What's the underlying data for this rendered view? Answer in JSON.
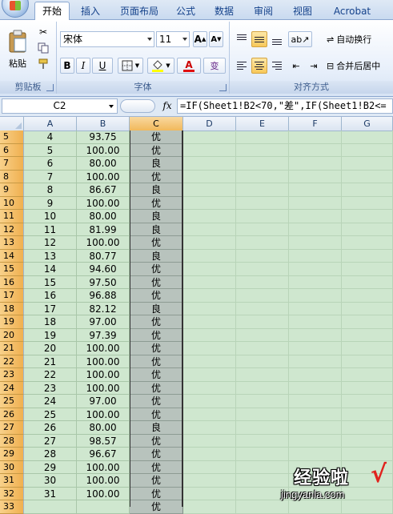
{
  "tabs": [
    "开始",
    "插入",
    "页面布局",
    "公式",
    "数据",
    "审阅",
    "视图",
    "Acrobat"
  ],
  "active_tab": "开始",
  "ribbon": {
    "clipboard": {
      "label": "剪贴板",
      "paste_label": "粘贴"
    },
    "font": {
      "label": "字体",
      "font_name": "宋体",
      "font_size": "11",
      "grow_label": "A",
      "shrink_label": "A",
      "bold": "B",
      "italic": "I",
      "underline": "U",
      "font_color_label": "A",
      "phonetic_label": "变"
    },
    "alignment": {
      "label": "对齐方式",
      "wrap_text": "自动换行",
      "merge_center": "合并后居中"
    }
  },
  "formula_bar": {
    "name_box": "C2",
    "fx": "fx",
    "formula": "=IF(Sheet1!B2<70,\"差\",IF(Sheet1!B2<="
  },
  "columns": [
    "A",
    "B",
    "C",
    "D",
    "E",
    "F",
    "G"
  ],
  "rows": [
    {
      "r": "5",
      "a": "4",
      "b": "93.75",
      "c": "优"
    },
    {
      "r": "6",
      "a": "5",
      "b": "100.00",
      "c": "优"
    },
    {
      "r": "7",
      "a": "6",
      "b": "80.00",
      "c": "良"
    },
    {
      "r": "8",
      "a": "7",
      "b": "100.00",
      "c": "优"
    },
    {
      "r": "9",
      "a": "8",
      "b": "86.67",
      "c": "良"
    },
    {
      "r": "10",
      "a": "9",
      "b": "100.00",
      "c": "优"
    },
    {
      "r": "11",
      "a": "10",
      "b": "80.00",
      "c": "良"
    },
    {
      "r": "12",
      "a": "11",
      "b": "81.99",
      "c": "良"
    },
    {
      "r": "13",
      "a": "12",
      "b": "100.00",
      "c": "优"
    },
    {
      "r": "14",
      "a": "13",
      "b": "80.77",
      "c": "良"
    },
    {
      "r": "15",
      "a": "14",
      "b": "94.60",
      "c": "优"
    },
    {
      "r": "16",
      "a": "15",
      "b": "97.50",
      "c": "优"
    },
    {
      "r": "17",
      "a": "16",
      "b": "96.88",
      "c": "优"
    },
    {
      "r": "18",
      "a": "17",
      "b": "82.12",
      "c": "良"
    },
    {
      "r": "19",
      "a": "18",
      "b": "97.00",
      "c": "优"
    },
    {
      "r": "20",
      "a": "19",
      "b": "97.39",
      "c": "优"
    },
    {
      "r": "21",
      "a": "20",
      "b": "100.00",
      "c": "优"
    },
    {
      "r": "22",
      "a": "21",
      "b": "100.00",
      "c": "优"
    },
    {
      "r": "23",
      "a": "22",
      "b": "100.00",
      "c": "优"
    },
    {
      "r": "24",
      "a": "23",
      "b": "100.00",
      "c": "优"
    },
    {
      "r": "25",
      "a": "24",
      "b": "97.00",
      "c": "优"
    },
    {
      "r": "26",
      "a": "25",
      "b": "100.00",
      "c": "优"
    },
    {
      "r": "27",
      "a": "26",
      "b": "80.00",
      "c": "良"
    },
    {
      "r": "28",
      "a": "27",
      "b": "98.57",
      "c": "优"
    },
    {
      "r": "29",
      "a": "28",
      "b": "96.67",
      "c": "优"
    },
    {
      "r": "30",
      "a": "29",
      "b": "100.00",
      "c": "优"
    },
    {
      "r": "31",
      "a": "30",
      "b": "100.00",
      "c": "优"
    },
    {
      "r": "32",
      "a": "31",
      "b": "100.00",
      "c": "优"
    },
    {
      "r": "33",
      "a": "",
      "b": "",
      "c": "优"
    }
  ],
  "watermark": {
    "text": "经验啦",
    "check": "√",
    "url": "jingyanla.com"
  },
  "colors": {
    "grid_bg": "#cfe7cf",
    "selected_col": "#b8c3bd",
    "row_header": "#f0b050",
    "ribbon_blue": "#15428b"
  }
}
